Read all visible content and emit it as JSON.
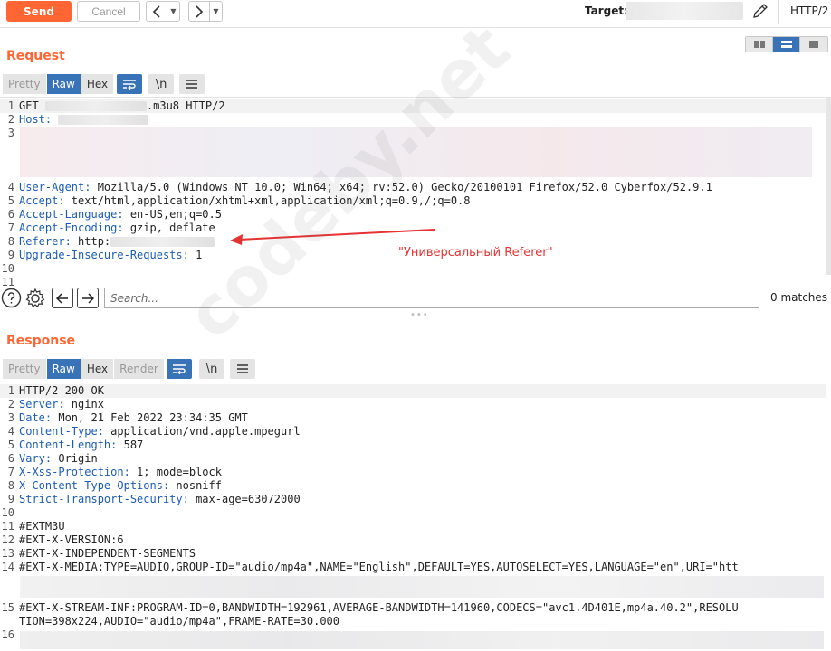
{
  "toolbar": {
    "send_label": "Send",
    "cancel_label": "Cancel",
    "back_glyph": "<",
    "forward_glyph": ">",
    "dropdown_glyph": "▼",
    "target_label": "Target:",
    "protocol": "HTTP/2",
    "edit_icon": "pencil-icon"
  },
  "request": {
    "title": "Request",
    "tabs": [
      {
        "label": "Pretty",
        "state": "disabled"
      },
      {
        "label": "Raw",
        "state": "active"
      },
      {
        "label": "Hex",
        "state": "normal"
      }
    ],
    "wrap_icon": "wrap-lines-icon",
    "newline_label": "\\n",
    "menu_icon": "hamburger-icon",
    "lines": [
      {
        "n": "1",
        "text": "GET ",
        "tail": ".m3u8 HTTP/2"
      },
      {
        "n": "2",
        "key": "Host:",
        "value": " "
      },
      {
        "n": "3",
        "key": "",
        "value": ""
      },
      {
        "n": "4",
        "key": "User-Agent:",
        "value": " Mozilla/5.0 (Windows NT 10.0; Win64; x64; rv:52.0) Gecko/20100101 Firefox/52.0 Cyberfox/52.9.1"
      },
      {
        "n": "5",
        "key": "Accept:",
        "value": " text/html,application/xhtml+xml,application/xml;q=0.9,/;q=0.8"
      },
      {
        "n": "6",
        "key": "Accept-Language:",
        "value": " en-US,en;q=0.5"
      },
      {
        "n": "7",
        "key": "Accept-Encoding:",
        "value": " gzip, deflate"
      },
      {
        "n": "8",
        "key": "Referer:",
        "value": " http:"
      },
      {
        "n": "9",
        "key": "Upgrade-Insecure-Requests:",
        "value": " 1"
      },
      {
        "n": "10",
        "key": "",
        "value": ""
      },
      {
        "n": "11",
        "key": "",
        "value": ""
      }
    ],
    "annotation": "\"Универсальный Referer\"",
    "search_placeholder": "Search...",
    "matches": "0 matches"
  },
  "response": {
    "title": "Response",
    "tabs": [
      {
        "label": "Pretty",
        "state": "disabled"
      },
      {
        "label": "Raw",
        "state": "active"
      },
      {
        "label": "Hex",
        "state": "normal"
      },
      {
        "label": "Render",
        "state": "disabled"
      }
    ],
    "lines": [
      {
        "n": "1",
        "key": "",
        "value": "HTTP/2 200 OK"
      },
      {
        "n": "2",
        "key": "Server:",
        "value": " nginx"
      },
      {
        "n": "3",
        "key": "Date:",
        "value": " Mon, 21 Feb 2022 23:34:35 GMT"
      },
      {
        "n": "4",
        "key": "Content-Type:",
        "value": " application/vnd.apple.mpegurl"
      },
      {
        "n": "5",
        "key": "Content-Length:",
        "value": " 587"
      },
      {
        "n": "6",
        "key": "Vary:",
        "value": " Origin"
      },
      {
        "n": "7",
        "key": "X-Xss-Protection:",
        "value": " 1; mode=block"
      },
      {
        "n": "8",
        "key": "X-Content-Type-Options:",
        "value": " nosniff"
      },
      {
        "n": "9",
        "key": "Strict-Transport-Security:",
        "value": " max-age=63072000"
      },
      {
        "n": "10",
        "key": "",
        "value": ""
      },
      {
        "n": "11",
        "key": "",
        "value": "#EXTM3U"
      },
      {
        "n": "12",
        "key": "",
        "value": "#EXT-X-VERSION:6"
      },
      {
        "n": "13",
        "key": "",
        "value": "#EXT-X-INDEPENDENT-SEGMENTS"
      },
      {
        "n": "14",
        "key": "",
        "value": "#EXT-X-MEDIA:TYPE=AUDIO,GROUP-ID=\"audio/mp4a\",NAME=\"English\",DEFAULT=YES,AUTOSELECT=YES,LANGUAGE=\"en\",URI=\"htt"
      },
      {
        "n": "15",
        "key": "",
        "value": "#EXT-X-STREAM-INF:PROGRAM-ID=0,BANDWIDTH=192961,AVERAGE-BANDWIDTH=141960,CODECS=\"avc1.4D401E,mp4a.40.2\",RESOLU"
      },
      {
        "n": "",
        "key": "",
        "value": "TION=398x224,AUDIO=\"audio/mp4a\",FRAME-RATE=30.000"
      },
      {
        "n": "16",
        "key": "",
        "value": ""
      }
    ]
  },
  "watermark": "codeby.net",
  "colors": {
    "accent": "#ff6633",
    "active_tab": "#3873b8",
    "header_key": "#1c5cb6",
    "annotation": "#e53232"
  }
}
